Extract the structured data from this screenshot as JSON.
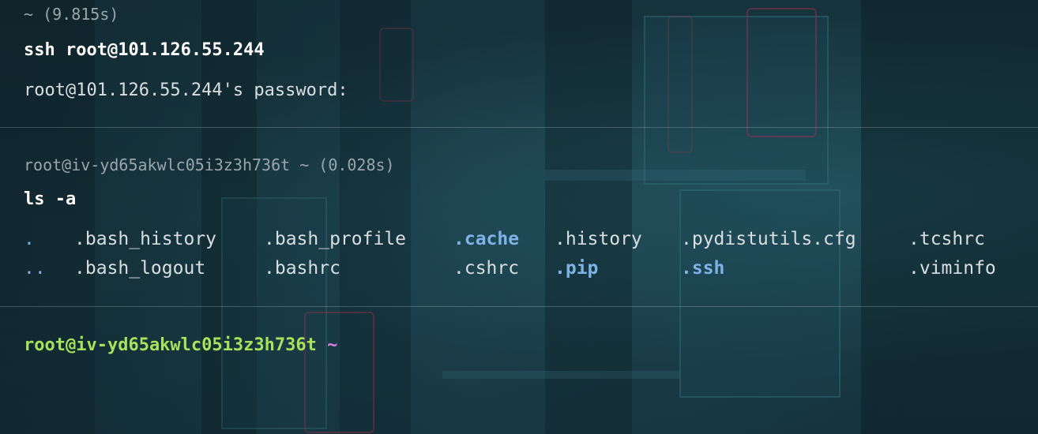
{
  "blocks": [
    {
      "header": "~ (9.815s)",
      "command": "ssh root@101.126.55.244",
      "output": "root@101.126.55.244's password:"
    },
    {
      "header": "root@iv-yd65akwlc05i3z3h736t ~ (0.028s)",
      "command": "ls -a",
      "listing": [
        [
          {
            "name": ".",
            "kind": "dir"
          },
          {
            "name": ".bash_history",
            "kind": "file"
          },
          {
            "name": ".bash_profile",
            "kind": "file"
          },
          {
            "name": ".cache",
            "kind": "dir"
          },
          {
            "name": ".history",
            "kind": "file"
          },
          {
            "name": ".pydistutils.cfg",
            "kind": "file"
          },
          {
            "name": ".tcshrc",
            "kind": "file"
          }
        ],
        [
          {
            "name": "..",
            "kind": "dir"
          },
          {
            "name": ".bash_logout",
            "kind": "file"
          },
          {
            "name": ".bashrc",
            "kind": "file"
          },
          {
            "name": ".cshrc",
            "kind": "file"
          },
          {
            "name": ".pip",
            "kind": "dir"
          },
          {
            "name": ".ssh",
            "kind": "dir"
          },
          {
            "name": ".viminfo",
            "kind": "file"
          }
        ]
      ]
    }
  ],
  "prompt": {
    "host": "root@iv-yd65akwlc05i3z3h736t",
    "cwd": "~"
  },
  "colors": {
    "prompt": "#a6e25a",
    "cwd": "#e07fe0",
    "directory": "#7fb2e6",
    "meta": "#9aa6ab"
  }
}
